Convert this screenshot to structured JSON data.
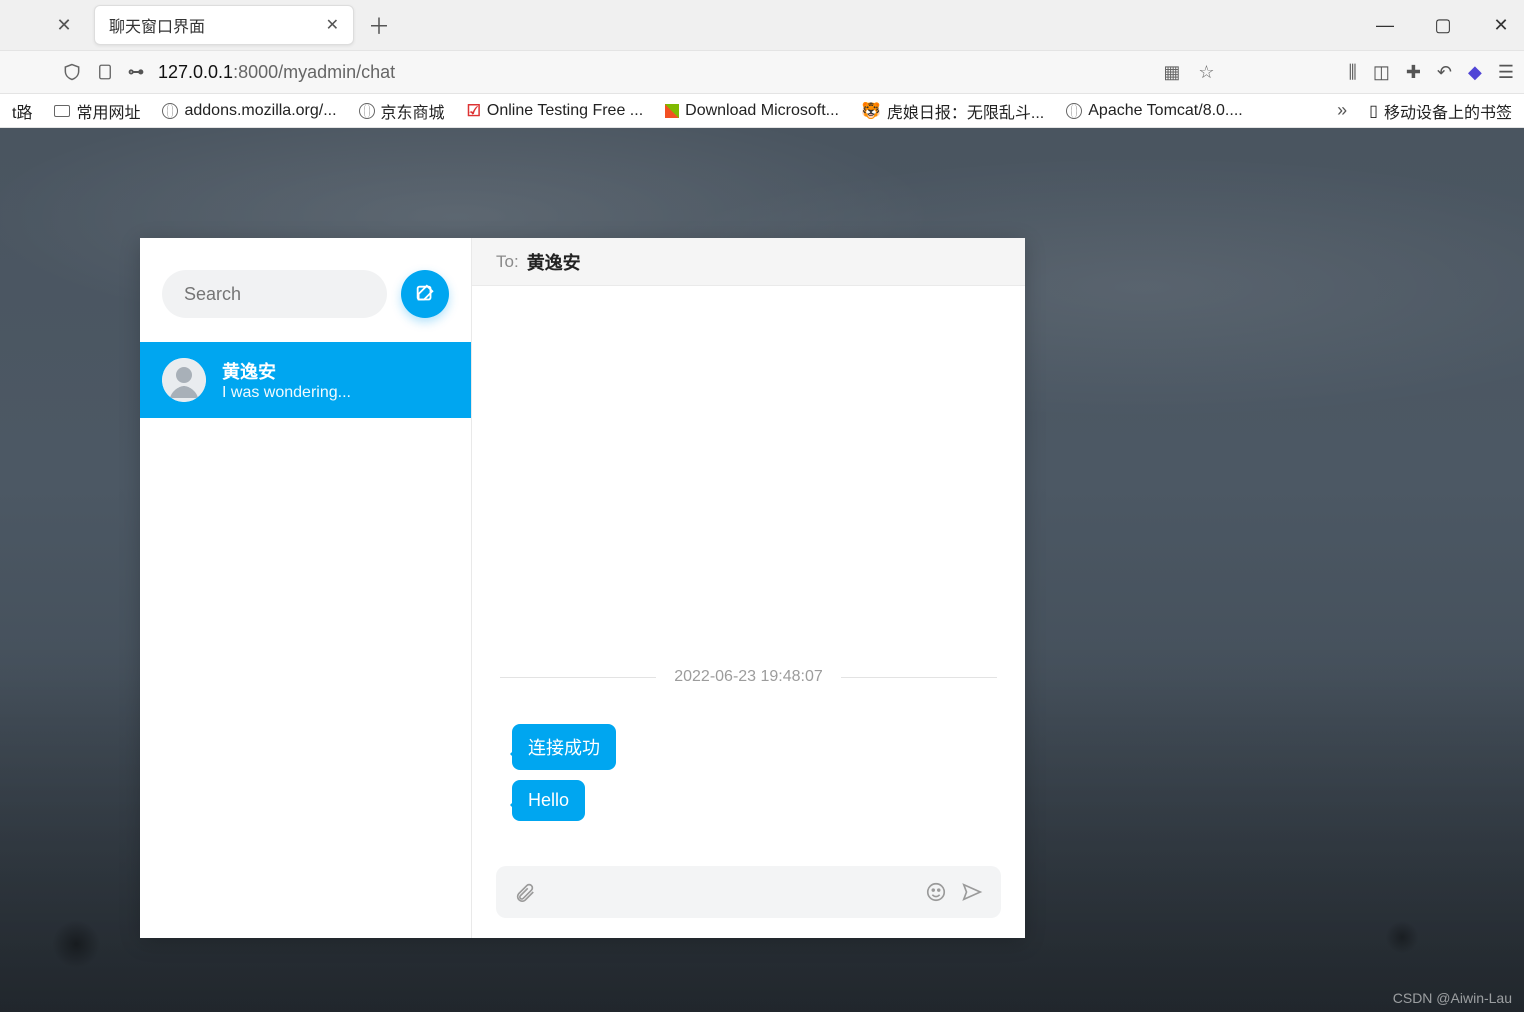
{
  "browser": {
    "tab_title": "聊天窗口界面",
    "url_host": "127.0.0.1",
    "url_port_path": ":8000/myadmin/chat",
    "bookmarks": [
      "t路",
      "常用网址",
      "addons.mozilla.org/...",
      "京东商城",
      "Online Testing Free ...",
      "Download Microsoft...",
      "虎娘日报：无限乱斗...",
      "Apache Tomcat/8.0...."
    ],
    "mobile_label": "移动设备上的书签"
  },
  "sidebar": {
    "search_placeholder": "Search",
    "person": {
      "name": "黄逸安",
      "preview": "I was wondering..."
    }
  },
  "chat": {
    "to_label": "To:",
    "to_name": "黄逸安",
    "timestamp": "2022-06-23 19:48:07",
    "messages": [
      {
        "text": "连接成功"
      },
      {
        "text": "Hello"
      }
    ]
  },
  "watermark": "CSDN @Aiwin-Lau"
}
